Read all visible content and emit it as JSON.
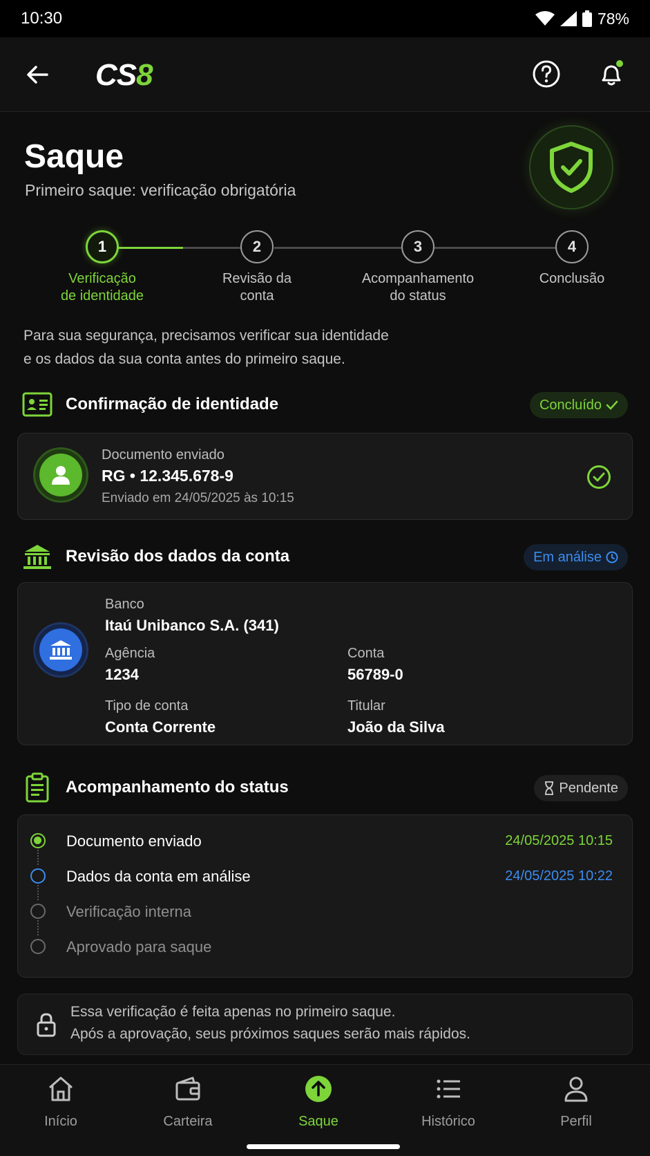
{
  "status_bar": {
    "time": "10:30",
    "battery": "78%"
  },
  "app": {
    "logo_cs": "CS",
    "logo_8": "8"
  },
  "page": {
    "title": "Saque",
    "subtitle": "Primeiro saque: verificação obrigatória"
  },
  "steps": [
    {
      "number": "1",
      "line1": "Verificação",
      "line2": "de identidade",
      "state": "active"
    },
    {
      "number": "2",
      "line1": "Revisão da",
      "line2": "conta",
      "state": "pending"
    },
    {
      "number": "3",
      "line1": "Acompanhamento",
      "line2": "do status",
      "state": "pending"
    },
    {
      "number": "4",
      "line1": "Conclusão",
      "line2": "",
      "state": "pending"
    }
  ],
  "intro": {
    "line1": "Para sua segurança, precisamos verificar sua identidade",
    "line2": "e os dados da sua conta antes do primeiro saque."
  },
  "identity": {
    "title": "Confirmação de identidade",
    "badge": "Concluído",
    "doc_label": "Documento enviado",
    "doc_type": "RG",
    "doc_number": "12.345.678-9",
    "sent_at": "Enviado em 24/05/2025 às 10:15"
  },
  "account_review": {
    "title": "Revisão dos dados da conta",
    "badge": "Em análise",
    "bank_label": "Banco",
    "bank_value": "Itaú Unibanco S.A. (341)",
    "agency_label": "Agência",
    "agency_value": "1234",
    "account_label": "Conta",
    "account_value": "56789-0",
    "type_label": "Tipo de conta",
    "type_value": "Conta Corrente",
    "holder_label": "Titular",
    "holder_value": "João da Silva"
  },
  "status_tracking": {
    "title": "Acompanhamento do status",
    "badge": "Pendente",
    "items": [
      {
        "label": "Documento enviado",
        "date": "24/05/2025 10:15",
        "state": "done"
      },
      {
        "label": "Dados da conta em análise",
        "date": "24/05/2025 10:22",
        "state": "current"
      },
      {
        "label": "Verificação interna",
        "date": "",
        "state": "pending"
      },
      {
        "label": "Aprovado para saque",
        "date": "",
        "state": "pending"
      }
    ]
  },
  "note": {
    "line1": "Essa verificação é feita apenas no primeiro saque.",
    "line2": "Após a aprovação, seus próximos saques serão mais rápidos."
  },
  "nav": [
    {
      "label": "Início",
      "icon": "home-icon"
    },
    {
      "label": "Carteira",
      "icon": "wallet-icon"
    },
    {
      "label": "Saque",
      "icon": "withdraw-icon",
      "active": true
    },
    {
      "label": "Histórico",
      "icon": "list-icon"
    },
    {
      "label": "Perfil",
      "icon": "user-icon"
    }
  ],
  "colors": {
    "accent_green": "#7dd53a",
    "accent_blue": "#3b8cf0",
    "background": "#0e0e0e",
    "card": "#191919"
  }
}
